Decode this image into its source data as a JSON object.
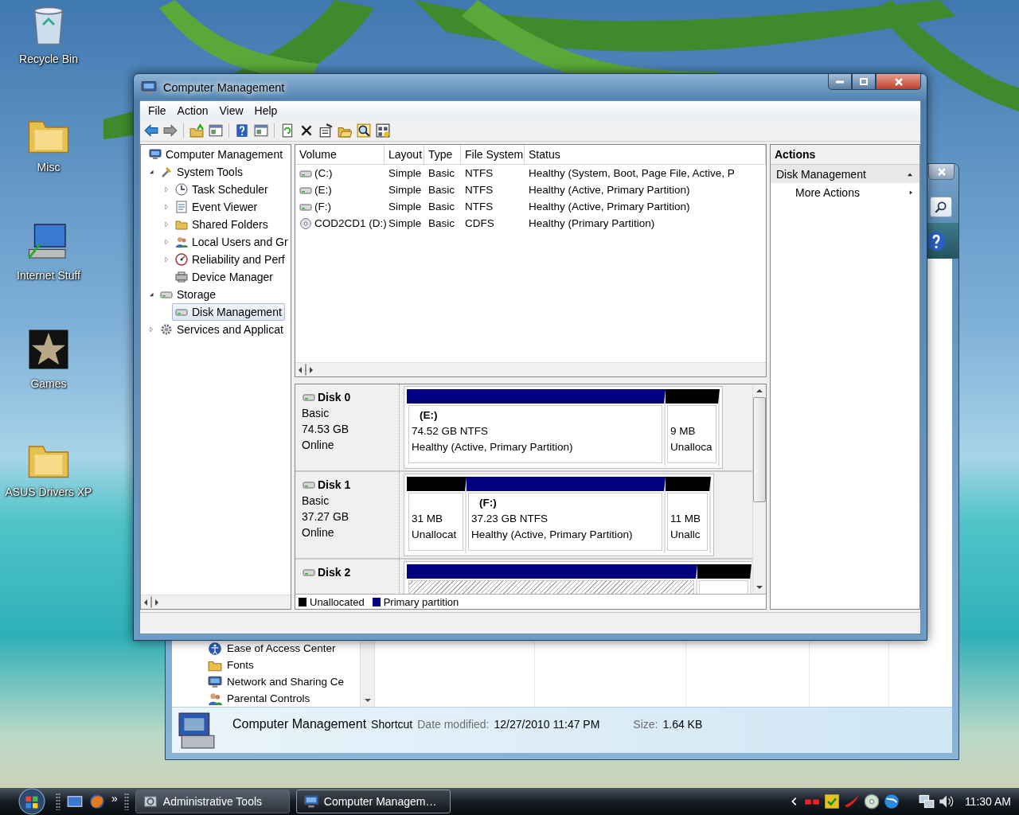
{
  "desktop_icons": [
    {
      "label": "Recycle Bin"
    },
    {
      "label": "Misc"
    },
    {
      "label": "Internet Stuff"
    },
    {
      "label": "Games"
    },
    {
      "label": "ASUS Drivers XP"
    }
  ],
  "explorer_window": {
    "nav_items": [
      {
        "label": "Ease of Access Center"
      },
      {
        "label": "Fonts"
      },
      {
        "label": "Network and Sharing Ce"
      },
      {
        "label": "Parental Controls"
      }
    ],
    "details": {
      "name": "Computer Management",
      "type": "Shortcut",
      "date_label": "Date modified:",
      "date": "12/27/2010 11:47 PM",
      "size_label": "Size:",
      "size": "1.64 KB"
    }
  },
  "main_window": {
    "title": "Computer Management",
    "menu": [
      "File",
      "Action",
      "View",
      "Help"
    ],
    "tree": [
      {
        "kind": "root",
        "label": "Computer Management",
        "selected": false,
        "children": [
          {
            "kind": "folder",
            "label": "System Tools",
            "expanded": true,
            "selected": false,
            "children": [
              {
                "kind": "folder",
                "label": "Task Scheduler",
                "expanded": false,
                "selected": false
              },
              {
                "kind": "folder",
                "label": "Event Viewer",
                "expanded": false,
                "selected": false
              },
              {
                "kind": "folder",
                "label": "Shared Folders",
                "expanded": false,
                "selected": false
              },
              {
                "kind": "folder",
                "label": "Local Users and Gr",
                "expanded": false,
                "selected": false
              },
              {
                "kind": "folder",
                "label": "Reliability and Perf",
                "expanded": false,
                "selected": false
              },
              {
                "kind": "leaf",
                "label": "Device Manager",
                "selected": false
              }
            ]
          },
          {
            "kind": "folder",
            "label": "Storage",
            "expanded": true,
            "selected": false,
            "children": [
              {
                "kind": "leaf",
                "label": "Disk Management",
                "selected": true
              }
            ]
          },
          {
            "kind": "folder",
            "label": "Services and Applicat",
            "expanded": false,
            "selected": false
          }
        ]
      }
    ],
    "volume_table": {
      "columns": [
        "Volume",
        "Layout",
        "Type",
        "File System",
        "Status"
      ],
      "rows": [
        {
          "kind": "drive",
          "cells": [
            "(C:)",
            "Simple",
            "Basic",
            "NTFS",
            "Healthy (System, Boot, Page File, Active, P"
          ]
        },
        {
          "kind": "drive",
          "cells": [
            "(E:)",
            "Simple",
            "Basic",
            "NTFS",
            "Healthy (Active, Primary Partition)"
          ]
        },
        {
          "kind": "drive",
          "cells": [
            "(F:)",
            "Simple",
            "Basic",
            "NTFS",
            "Healthy (Active, Primary Partition)"
          ]
        },
        {
          "kind": "cd",
          "cells": [
            "COD2CD1 (D:)",
            "Simple",
            "Basic",
            "CDFS",
            "Healthy (Primary Partition)"
          ]
        }
      ]
    },
    "disks": [
      {
        "name": "Disk 0",
        "type": "Basic",
        "size": "74.53 GB",
        "status": "Online",
        "partitions": [
          {
            "kind": "primary",
            "selected": false,
            "drive": "(E:)",
            "size": "74.52 GB NTFS",
            "status": "Healthy (Active, Primary Partition)"
          },
          {
            "kind": "unallocated",
            "selected": false,
            "size": "9 MB",
            "status": "Unalloca"
          }
        ]
      },
      {
        "name": "Disk 1",
        "type": "Basic",
        "size": "37.27 GB",
        "status": "Online",
        "partitions": [
          {
            "kind": "unallocated",
            "selected": false,
            "size": "31 MB",
            "status": "Unallocat"
          },
          {
            "kind": "primary",
            "selected": false,
            "drive": "(F:)",
            "size": "37.23 GB NTFS",
            "status": "Healthy (Active, Primary Partition)"
          },
          {
            "kind": "unallocated",
            "selected": false,
            "size": "11 MB",
            "status": "Unallc"
          }
        ]
      },
      {
        "name": "Disk 2",
        "partitions": [
          {
            "kind": "primary",
            "selected": true
          },
          {
            "kind": "unallocated",
            "selected": false
          }
        ]
      }
    ],
    "legend": [
      {
        "kind": "unallocated",
        "label": "Unallocated"
      },
      {
        "kind": "primary",
        "label": "Primary partition"
      }
    ],
    "actions": {
      "title": "Actions",
      "items": [
        {
          "kind": "section",
          "label": "Disk Management",
          "expanded": true
        },
        {
          "kind": "action",
          "label": "More Actions"
        }
      ]
    }
  },
  "taskbar": {
    "more": "»",
    "buttons": [
      {
        "label": "Administrative Tools",
        "selected": false
      },
      {
        "label": "Computer Managem…",
        "selected": true
      }
    ],
    "clock": "11:30 AM"
  }
}
